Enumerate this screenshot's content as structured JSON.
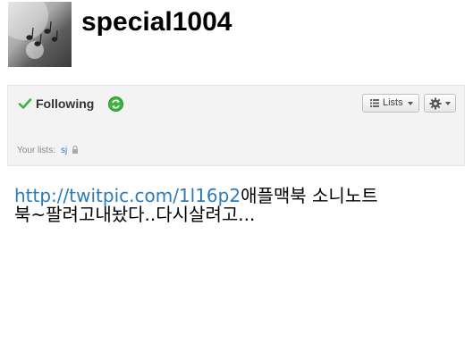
{
  "profile": {
    "username": "special1004",
    "avatar_icon": "music-notes-avatar"
  },
  "actions": {
    "following_label": "Following",
    "following_icon": "checkmark-icon",
    "refresh_icon": "refresh-icon",
    "lists_label": "Lists",
    "gear_icon": "gear-icon"
  },
  "lists": {
    "label": "Your lists:",
    "items": [
      "sj"
    ],
    "lock_icon": "lock-icon"
  },
  "tweet": {
    "link": "http://twitpic.com/1l16p2",
    "text": "애플맥북 소니노트북~팔려고내놨다..다시살려고..."
  },
  "colors": {
    "link": "#2b7bb9",
    "check": "#3fb33f",
    "panel_bg": "#f3f3f3"
  }
}
